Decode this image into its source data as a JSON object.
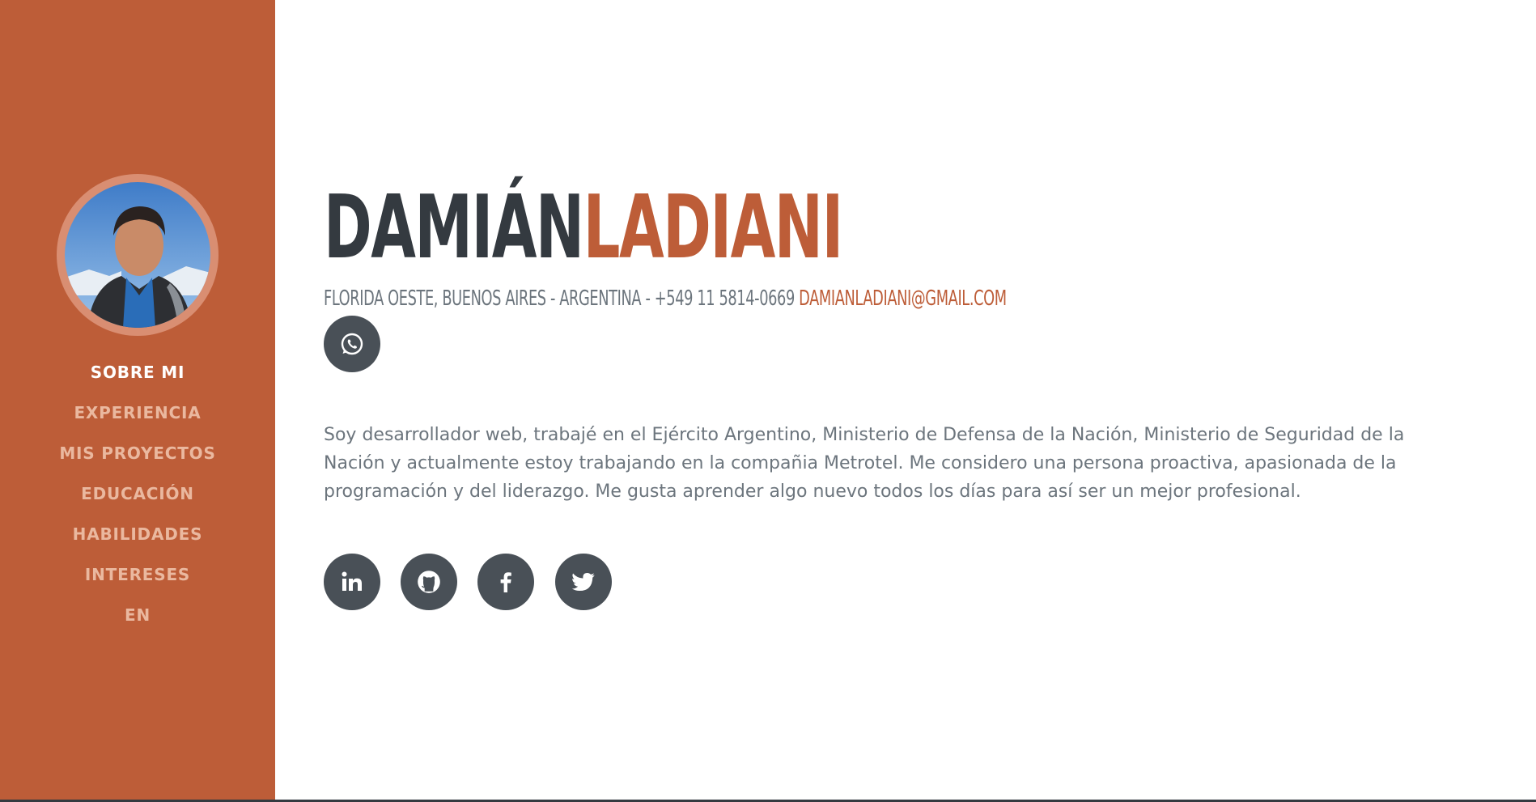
{
  "sidebar": {
    "avatar_alt": "Profile photo",
    "items": [
      {
        "label": "SOBRE MI",
        "active": true
      },
      {
        "label": "EXPERIENCIA"
      },
      {
        "label": "MIS PROYECTOS"
      },
      {
        "label": "EDUCACIÓN"
      },
      {
        "label": "HABILIDADES"
      },
      {
        "label": "INTERESES"
      },
      {
        "label": "EN"
      }
    ]
  },
  "header": {
    "first_name": "DAMIÁN",
    "last_name": "LADIANI",
    "location_phone": "FLORIDA OESTE, BUENOS AIRES - ARGENTINA - +549 11 5814-0669",
    "email": "DAMIANLADIANI@GMAIL.COM"
  },
  "bio": "Soy desarrollador web, trabajé en el Ejército Argentino, Ministerio de Defensa de la Nación, Ministerio de Seguridad de la Nación y actualmente estoy trabajando en la compañia Metrotel. Me considero una persona proactiva, apasionada de la programación y del liderazgo. Me gusta aprender algo nuevo todos los días para así ser un mejor profesional.",
  "icons": {
    "whatsapp": "whatsapp-icon",
    "social": [
      "linkedin-icon",
      "github-icon",
      "facebook-icon",
      "twitter-icon"
    ]
  },
  "colors": {
    "primary": "#bd5d38",
    "dark": "#343a40",
    "button": "#495057",
    "muted": "#6c757d",
    "nav_inactive": "#eab89f",
    "ring": "#d98e72"
  }
}
